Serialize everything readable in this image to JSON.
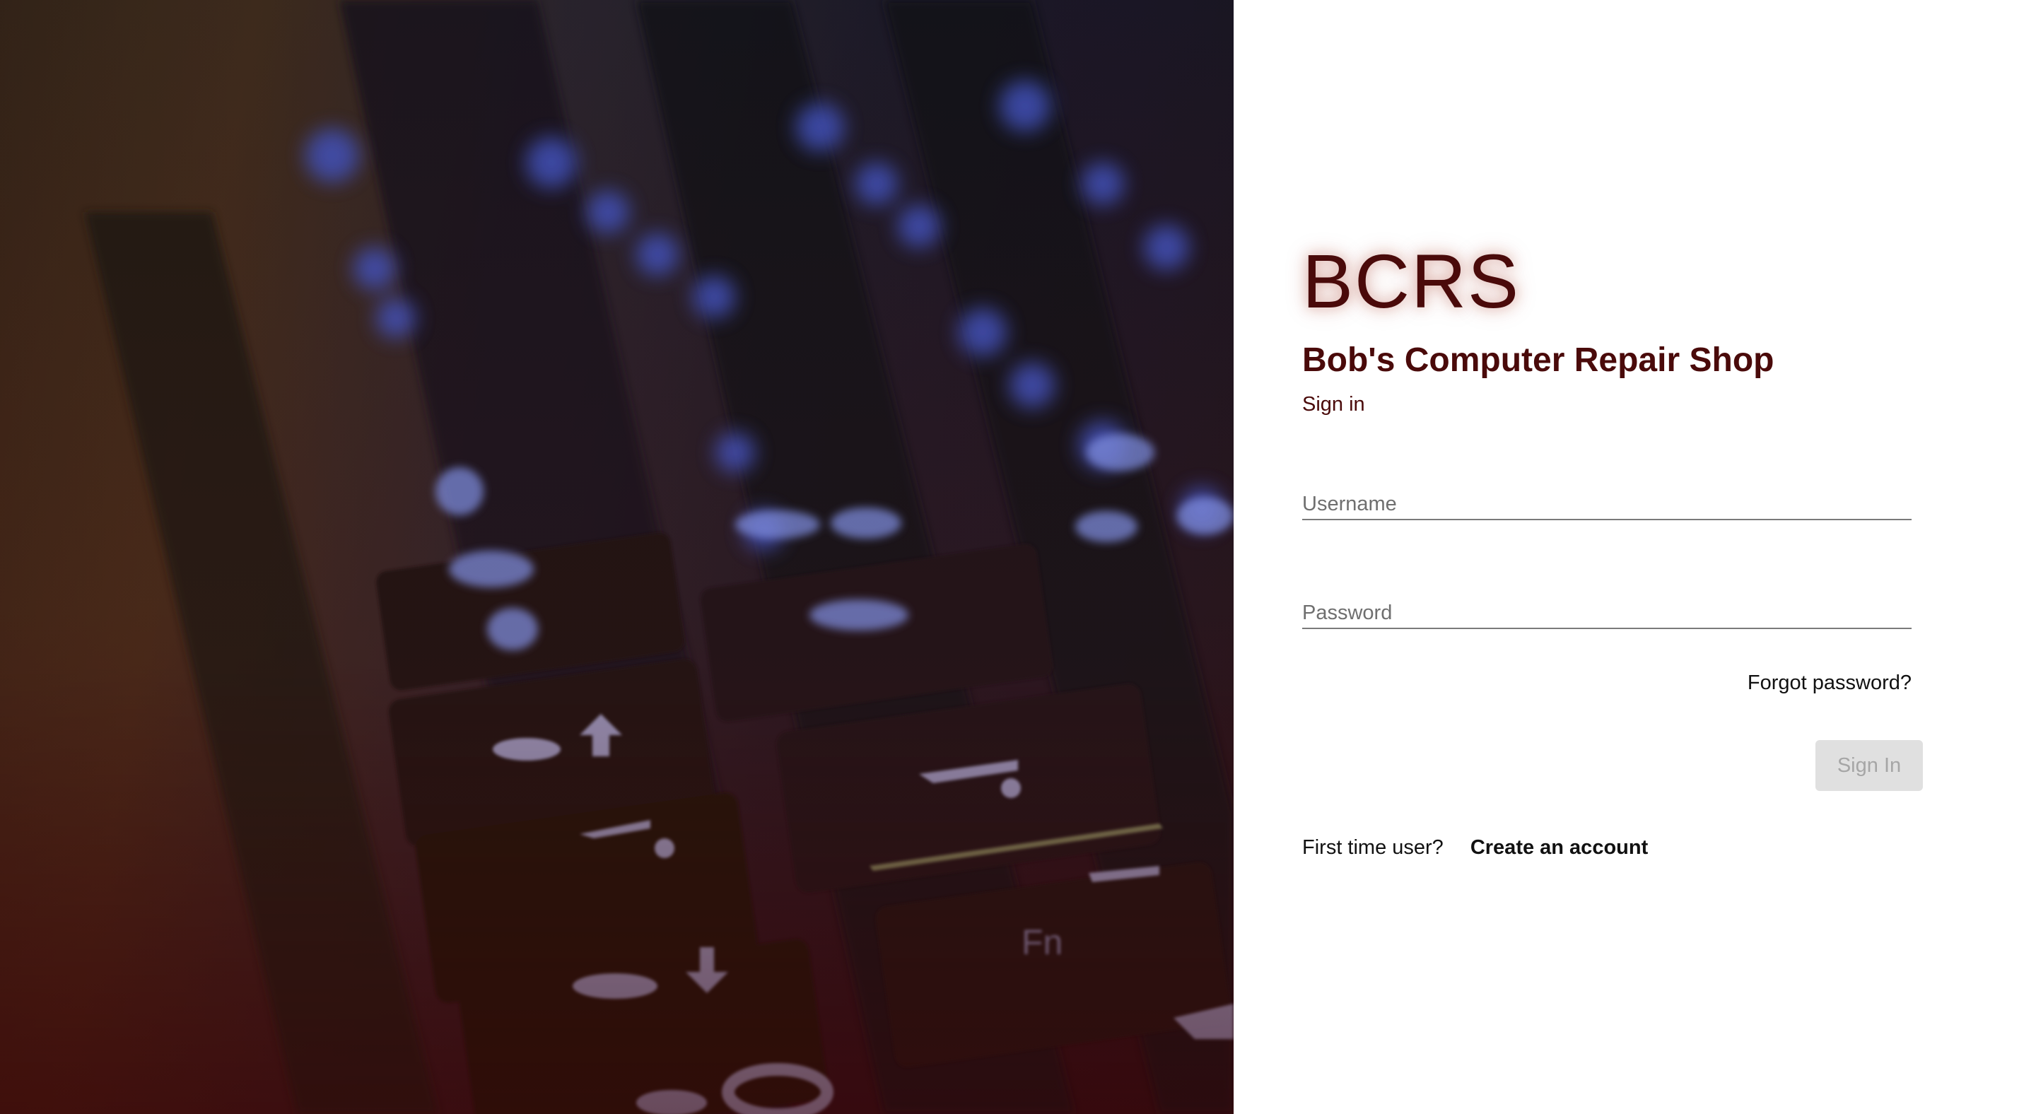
{
  "hero": {
    "image_description_icon": "keyboard-photo"
  },
  "brand": {
    "logo_text": "BCRS",
    "shop_name": "Bob's Computer Repair Shop",
    "accent_color": "#4a0a0a"
  },
  "form": {
    "heading": "Sign in",
    "username_placeholder": "Username",
    "username_value": "",
    "password_placeholder": "Password",
    "password_value": "",
    "forgot_password": "Forgot password?",
    "sign_in_button": "Sign In",
    "first_time_user": "First time user?",
    "create_account": "Create an account"
  }
}
